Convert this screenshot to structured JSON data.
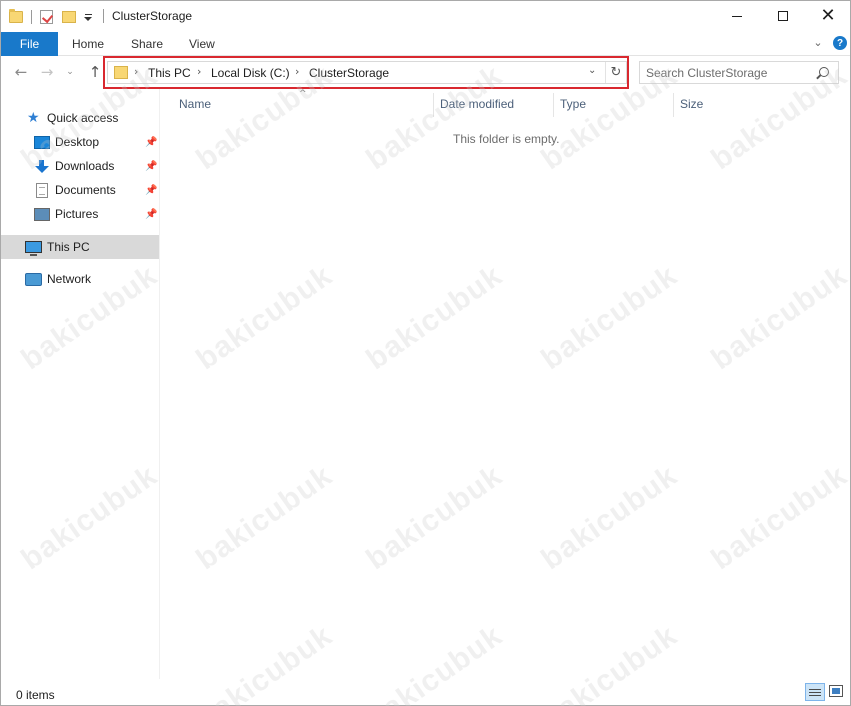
{
  "window": {
    "title": "ClusterStorage"
  },
  "ribbon": {
    "file_label": "File",
    "tabs": [
      "Home",
      "Share",
      "View"
    ]
  },
  "address": {
    "crumbs": [
      "This PC",
      "Local Disk (C:)",
      "ClusterStorage"
    ],
    "highlight_color": "#d9282f"
  },
  "search": {
    "placeholder": "Search ClusterStorage"
  },
  "navpane": {
    "quick_access": "Quick access",
    "pinned": [
      "Desktop",
      "Downloads",
      "Documents",
      "Pictures"
    ],
    "this_pc": "This PC",
    "network": "Network"
  },
  "columns": {
    "name": "Name",
    "date_modified": "Date modified",
    "type": "Type",
    "size": "Size"
  },
  "content": {
    "empty_message": "This folder is empty."
  },
  "status": {
    "item_count": "0 items"
  },
  "watermark": {
    "text": "bakicubuk"
  },
  "colors": {
    "accent": "#1979ca",
    "selection": "#d9d9d9"
  }
}
